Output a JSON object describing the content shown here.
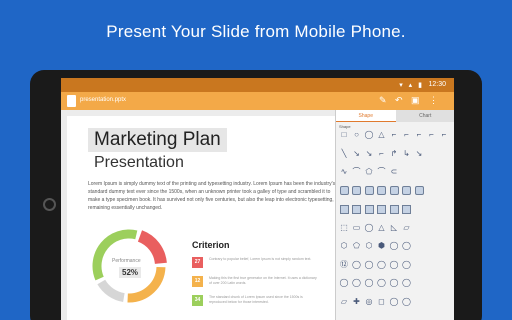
{
  "headline": "Present Your Slide from Mobile Phone.",
  "status": {
    "time": "12:30",
    "icons": "▾ ▴ ▮"
  },
  "appbar": {
    "file_name": "presentation.pptx",
    "tool_icons": [
      "pen-icon",
      "undo-icon",
      "save-icon",
      "more-icon"
    ],
    "tool_glyphs": [
      "✎",
      "↶",
      "▣",
      "⋮"
    ]
  },
  "slide": {
    "title": "Marketing Plan",
    "subtitle": "Presentation",
    "paragraph": "Lorem Ipsum is simply dummy text of the printing and typesetting industry. Lorem Ipsum has been the industry's standard dummy text ever since the 1500s, when an unknown printer took a galley of type and scrambled it to make a type specimen book. It has survived not only five centuries, but also the leap into electronic typesetting, remaining essentially unchanged.",
    "performance_label": "Performance",
    "performance_value": "52%",
    "donut_segments": [
      {
        "color": "#e95f5f",
        "value": 0.2
      },
      {
        "color": "#f4b24c",
        "value": 0.27
      },
      {
        "color": "#d6d6d6",
        "value": 0.16
      },
      {
        "color": "#9ccf5c",
        "value": 0.37
      }
    ],
    "criterion_title": "Criterion",
    "criteria": [
      {
        "value": "27",
        "color": "#e95f5f",
        "text": "Contrary to popular belief, Lorem Ipsum is not simply random text."
      },
      {
        "value": "12",
        "color": "#f4b24c",
        "text": "Making this the first true generator on the Internet. It uses a dictionary of over 200 Latin words."
      },
      {
        "value": "34",
        "color": "#9ccf5c",
        "text": "The standard chunk of Lorem Ipsum used since the 1500s is reproduced below for those interested."
      }
    ]
  },
  "panel": {
    "tabs": [
      {
        "label": "Shape",
        "active": true
      },
      {
        "label": "Chart",
        "active": false
      }
    ],
    "section_label": "Shape",
    "rows": [
      [
        "□",
        "○",
        "◯",
        "△",
        "⌐",
        "⌐",
        "⌐",
        "⌐",
        "⌐"
      ],
      [
        "╲",
        "↘",
        "↘",
        "⌐",
        "↱",
        "↳",
        "↘",
        "",
        ""
      ],
      [
        "∿",
        "⌒",
        "⬠",
        "⌒",
        "⊂",
        "",
        "",
        "",
        ""
      ],
      [
        "■",
        "■",
        "■",
        "■",
        "■",
        "■",
        "■",
        "",
        ""
      ],
      [
        "■",
        "■",
        "■",
        "■",
        "■",
        "■",
        "",
        "",
        ""
      ],
      [
        "⬚",
        "▭",
        "◯",
        "△",
        "◺",
        "▱",
        "",
        "",
        ""
      ],
      [
        "⬡",
        "⬠",
        "⬡",
        "⬢",
        "◯",
        "◯",
        "",
        "",
        ""
      ],
      [
        "⑫",
        "◯",
        "◯",
        "◯",
        "◯",
        "◯",
        "",
        "",
        ""
      ],
      [
        "◯",
        "◯",
        "◯",
        "◯",
        "◯",
        "◯",
        "",
        "",
        ""
      ],
      [
        "▱",
        "✚",
        "◎",
        "◻",
        "◯",
        "◯",
        "",
        "",
        ""
      ]
    ]
  }
}
